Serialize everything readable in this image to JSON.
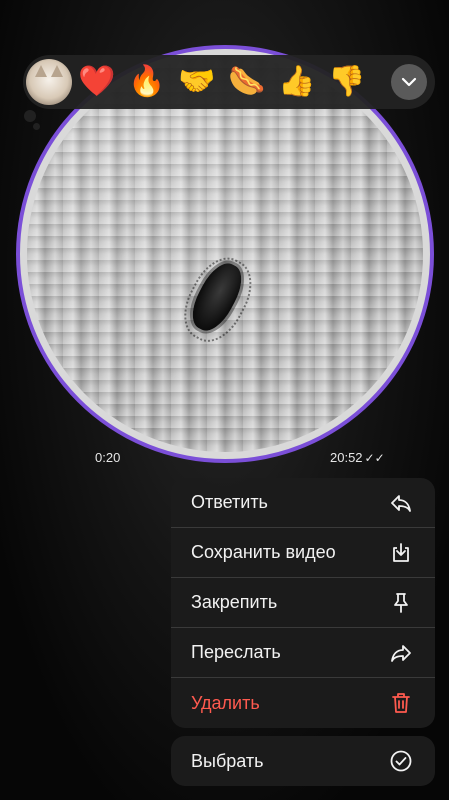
{
  "video": {
    "duration": "0:20",
    "sent_time": "20:52",
    "status_ticks": "✓✓"
  },
  "reactions": {
    "items": [
      {
        "emoji": "❤️",
        "name": "heart"
      },
      {
        "emoji": "🔥",
        "name": "fire"
      },
      {
        "emoji": "🤝",
        "name": "handshake"
      },
      {
        "emoji": "🌭",
        "name": "hotdog"
      },
      {
        "emoji": "👍",
        "name": "thumbs-up"
      },
      {
        "emoji": "👎",
        "name": "thumbs-down"
      }
    ],
    "expand_icon": "chevron-down-icon"
  },
  "menu": {
    "reply": "Ответить",
    "save_video": "Сохранить видео",
    "pin": "Закрепить",
    "forward": "Переслать",
    "delete": "Удалить",
    "select": "Выбрать"
  },
  "colors": {
    "accent": "#7b4fd8",
    "danger": "#ff5a4f"
  }
}
